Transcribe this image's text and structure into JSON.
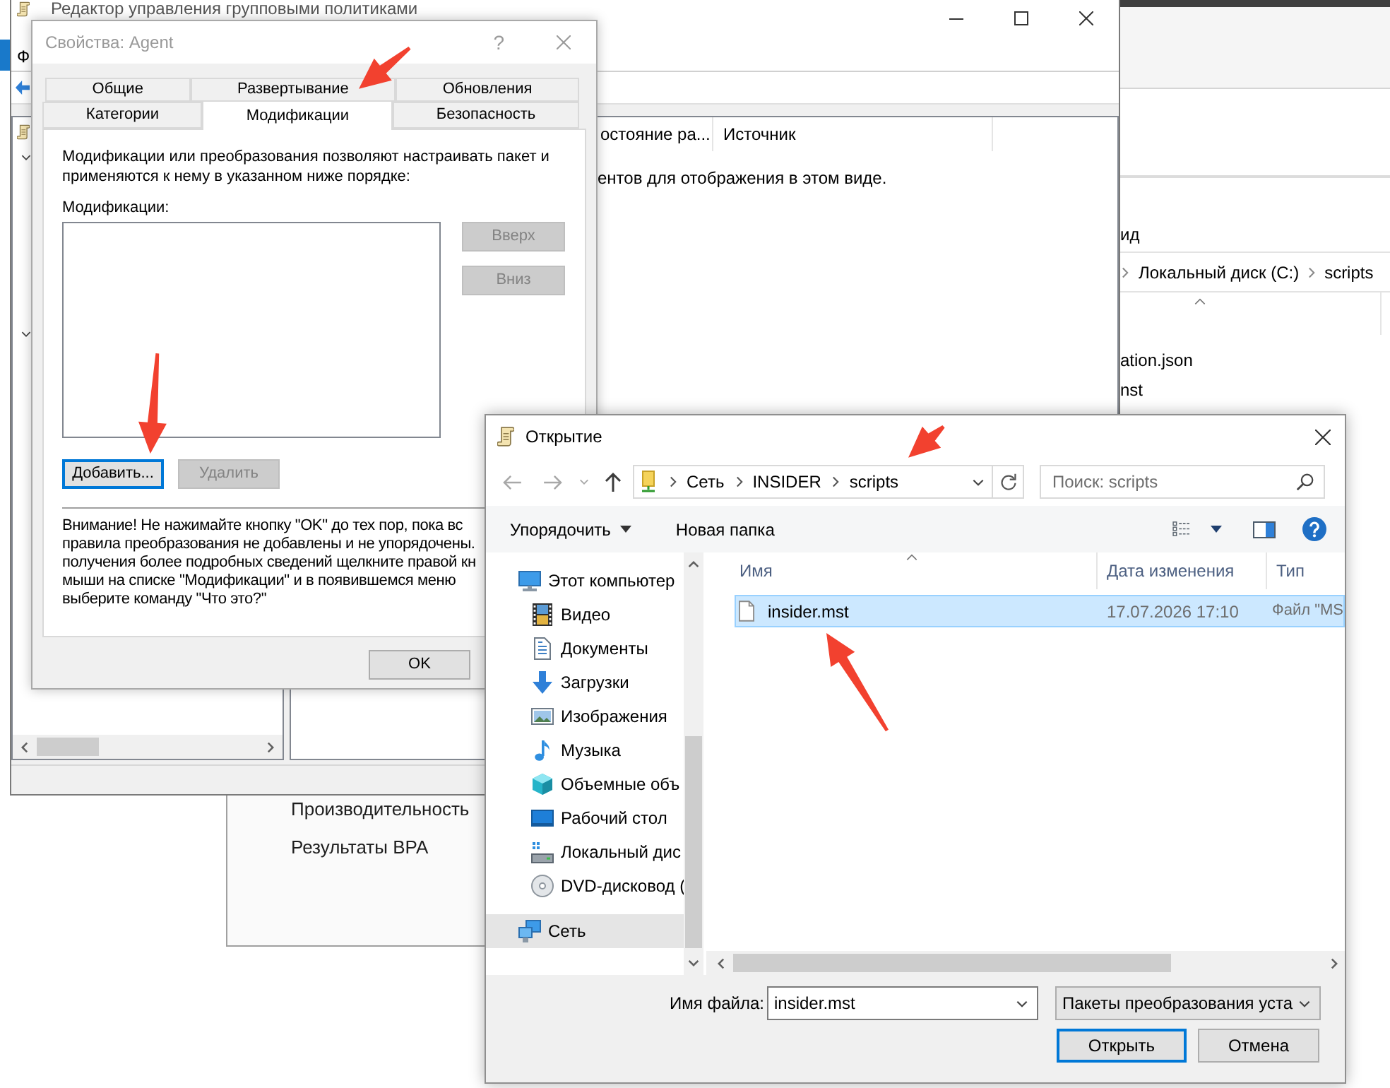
{
  "server_manager": {
    "items": [
      "Производительность",
      "Результаты BPA"
    ]
  },
  "explorer_window": {
    "ribbon_tab": "ид",
    "path": [
      "Локальный диск (C:)",
      "scripts"
    ],
    "files": [
      "ation.json",
      "nst"
    ]
  },
  "editor_window": {
    "title": "Редактор управления групповыми политиками",
    "menu": [
      "Ф"
    ],
    "tree_toggles": [
      {
        "expanded": true
      },
      {
        "expanded": true
      }
    ],
    "columns": [
      "остояние ра...",
      "Источник"
    ],
    "empty_message": "ентов для отображения в этом виде."
  },
  "properties_dialog": {
    "title": "Свойства: Agent",
    "help": "?",
    "tab_rows": [
      {
        "tabs": [
          {
            "label": "Общие",
            "selected": false
          },
          {
            "label": "Развертывание",
            "selected": false
          },
          {
            "label": "Обновления",
            "selected": false
          }
        ]
      },
      {
        "tabs": [
          {
            "label": "Категории",
            "selected": false
          },
          {
            "label": "Модификации",
            "selected": true
          },
          {
            "label": "Безопасность",
            "selected": false
          }
        ]
      }
    ],
    "description_lines": [
      "Модификации или преобразования позволяют настраивать пакет и",
      "применяются к нему в указанном ниже порядке:"
    ],
    "list_label": "Модификации:",
    "order_buttons": [
      {
        "label": "Вверх",
        "disabled": true
      },
      {
        "label": "Вниз",
        "disabled": true
      }
    ],
    "edit_buttons": [
      {
        "label": "Добавить...",
        "disabled": false,
        "focused": true
      },
      {
        "label": "Удалить",
        "disabled": true,
        "focused": false
      }
    ],
    "warning_lines": [
      "Внимание! Не нажимайте кнопку \"OK\" до тех пор, пока вс",
      "правила преобразования не добавлены и не упорядочены.",
      "получения более подробных сведений щелкните правой кн",
      "мыши на списке \"Модификации\" и в появившемся меню",
      "выберите команду \"Что это?\""
    ],
    "footer_buttons": [
      {
        "label": "OK"
      }
    ]
  },
  "open_dialog": {
    "title": "Открытие",
    "address": [
      "Сеть",
      "INSIDER",
      "scripts"
    ],
    "search": {
      "placeholder": "Поиск: scripts"
    },
    "toolbar": [
      {
        "label": "Упорядочить",
        "dropdown": true
      },
      {
        "label": "Новая папка",
        "dropdown": false
      }
    ],
    "nav": [
      {
        "label": "Этот компьютер",
        "kind": "computer",
        "selected": false,
        "children": [
          {
            "label": "Видео",
            "kind": "video",
            "selected": false
          },
          {
            "label": "Документы",
            "kind": "documents",
            "selected": false
          },
          {
            "label": "Загрузки",
            "kind": "downloads",
            "selected": false
          },
          {
            "label": "Изображения",
            "kind": "pictures",
            "selected": false
          },
          {
            "label": "Музыка",
            "kind": "music",
            "selected": false
          },
          {
            "label": "Объемные объ",
            "kind": "objects",
            "selected": false
          },
          {
            "label": "Рабочий стол",
            "kind": "desktop",
            "selected": false
          },
          {
            "label": "Локальный дис",
            "kind": "drive",
            "selected": false
          },
          {
            "label": "DVD-дисковод (",
            "kind": "dvd",
            "selected": false
          }
        ]
      },
      {
        "label": "Сеть",
        "kind": "network",
        "selected": true
      }
    ],
    "columns": [
      "Имя",
      "Дата изменения",
      "Тип"
    ],
    "files": [
      {
        "name": "insider.mst",
        "modified": "17.07.2026 17:10",
        "type": "Файл \"MS",
        "selected": true
      }
    ],
    "file_name": {
      "label": "Имя файла:",
      "value": "insider.mst"
    },
    "file_type": "Пакеты преобразования уста",
    "buttons": [
      {
        "label": "Открыть",
        "focused": true
      },
      {
        "label": "Отмена",
        "focused": false
      }
    ]
  }
}
